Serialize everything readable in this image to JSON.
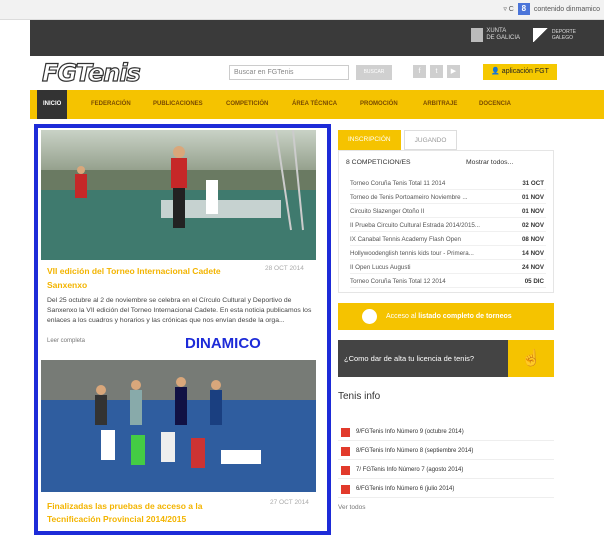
{
  "browser": {
    "tab_text": "contenido dinmamico"
  },
  "top_logos": {
    "xunta_line1": "XUNTA",
    "xunta_line2": "DE GALICIA",
    "deporte_line1": "DEPORTE",
    "deporte_line2": "GALEGO"
  },
  "header": {
    "logo": "FGTenis",
    "search_placeholder": "Buscar en FGTenis",
    "search_button": "BUSCAR",
    "app_button": "aplicación FGT"
  },
  "nav": {
    "items": [
      "INICIO",
      "FEDERACIÓN",
      "PUBLICACIONES",
      "COMPETICIÓN",
      "ÁREA TÉCNICA",
      "PROMOCIÓN",
      "ARBITRAJE",
      "DOCENCIA"
    ]
  },
  "news": {
    "title1": "VII edición del Torneo Internacional Cadete Sanxenxo",
    "date1": "28 OCT 2014",
    "text1": "Del 25 octubre al 2 de noviembre se celebra en el Círculo Cultural y Deportivo de Sanxenxo la VII edición del Torneo Internacional Cadete. En esta noticia publicamos los enlaces a los cuadros y horarios y las crónicas que nos envían desde la orga...",
    "read_more": "Leer completa",
    "overlay": "DINAMICO",
    "title2": "Finalizadas las pruebas de acceso a la Tecnificación Provincial 2014/2015",
    "date2": "27 OCT 2014"
  },
  "tabs": [
    "INSCRIPCIÓN",
    "JUGANDO"
  ],
  "competitions": {
    "header": "8 COMPETICION/ES",
    "show_all": "Mostrar todos...",
    "rows": [
      {
        "name": "Torneo Coruña Tenis Total 11 2014",
        "date": "31 OCT"
      },
      {
        "name": "Torneo de Tenis Portoameiro Noviembre ...",
        "date": "01 NOV"
      },
      {
        "name": "Circuito Slazenger Otoño II",
        "date": "01 NOV"
      },
      {
        "name": "II Prueba Circuito Cultural Estrada 2014/2015...",
        "date": "02 NOV"
      },
      {
        "name": "IX Canabal Tennis Academy Flash Open",
        "date": "08 NOV"
      },
      {
        "name": "Hollywoodenglish tennis kids tour - Primera...",
        "date": "14 NOV"
      },
      {
        "name": "II Open Lucus Augusti",
        "date": "24 NOV"
      },
      {
        "name": "Torneo Coruña Tenis Total 12 2014",
        "date": "05 DIC"
      }
    ]
  },
  "acceso": {
    "prefix": "Acceso al ",
    "bold": "listado completo de torneos"
  },
  "licencia": {
    "text": "¿Como dar de alta tu licencia de tenis?"
  },
  "tenis_info": {
    "title": "Tenis info",
    "items": [
      "9/FGTenis Info Número 9 (octubre 2014)",
      "8/FGTenis Info Número 8 (septiembre 2014)",
      "7/ FGTenis Info Número 7 (agosto 2014)",
      "6/FGTenis Info Número 6 (julio 2014)"
    ],
    "see_all": "Ver todos"
  }
}
